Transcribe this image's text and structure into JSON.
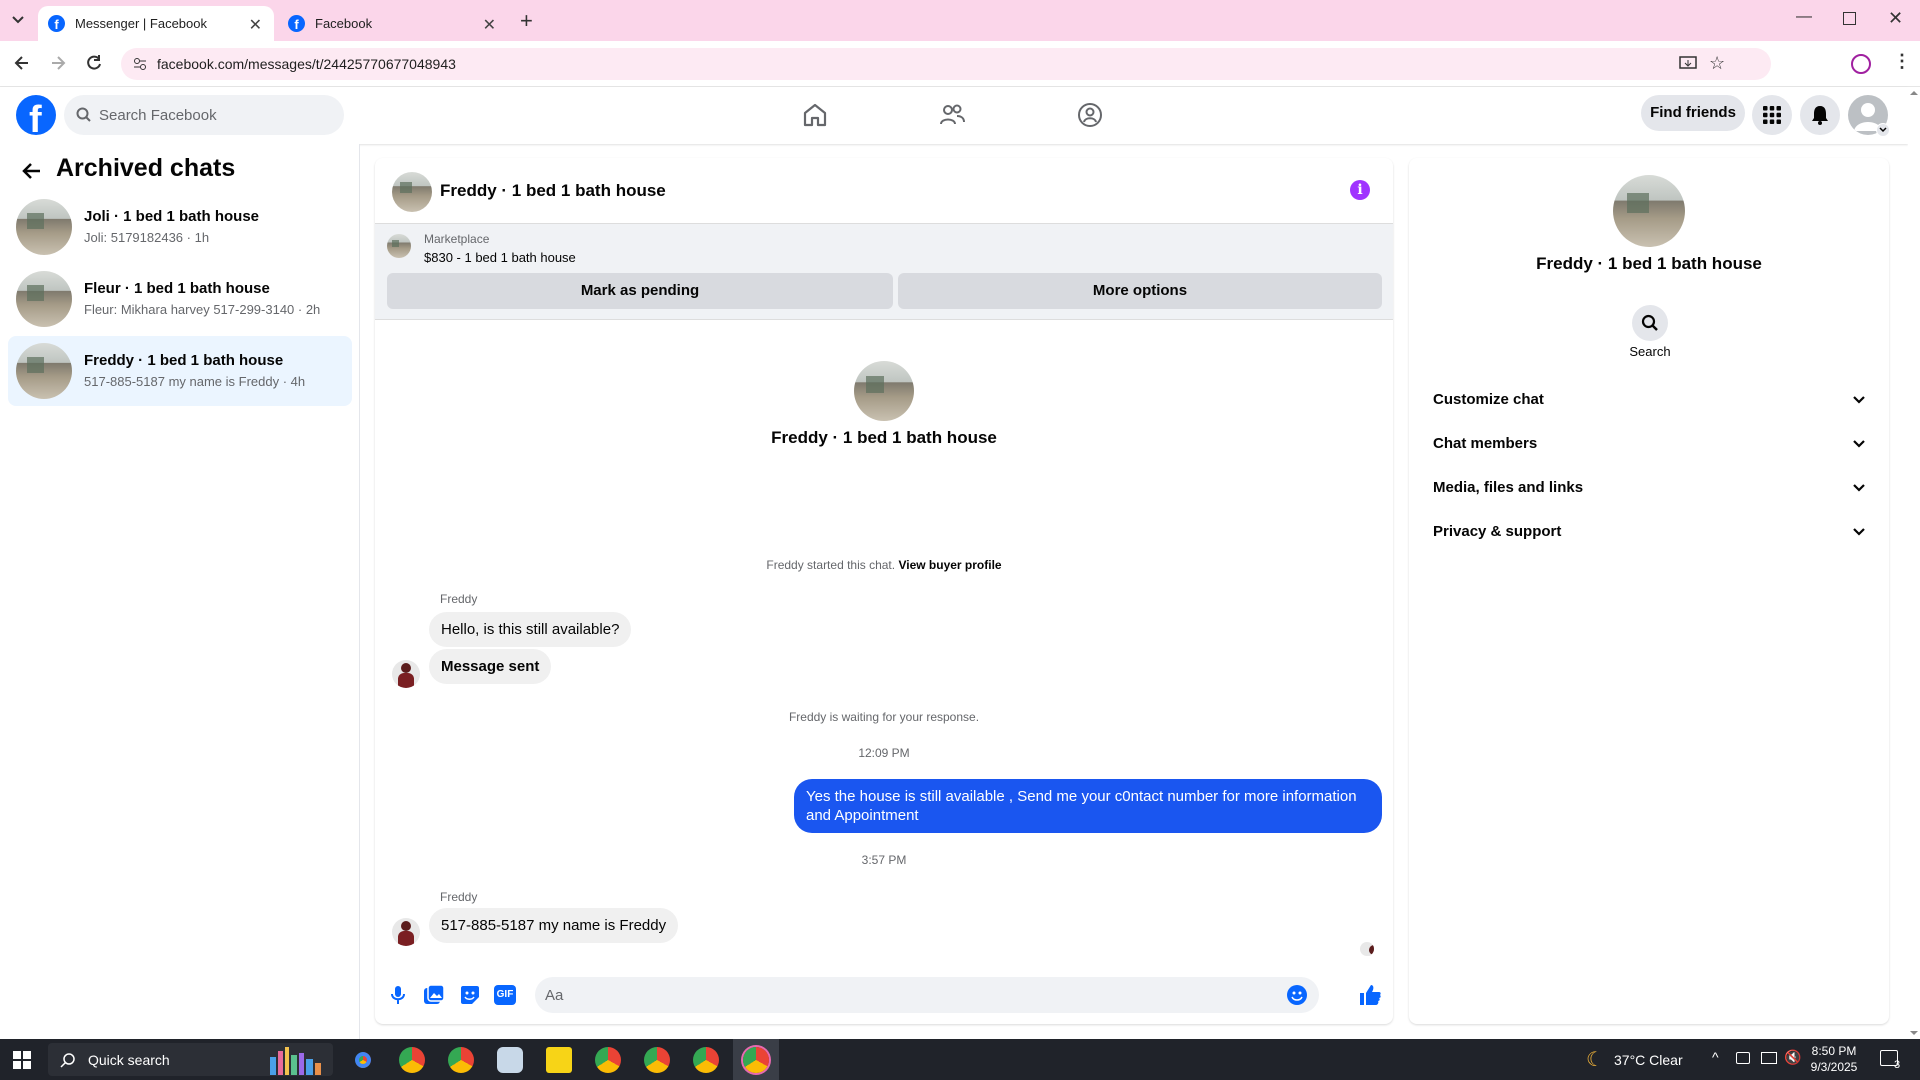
{
  "browser": {
    "tabs": [
      {
        "label": "Messenger | Facebook",
        "active": true
      },
      {
        "label": "Facebook",
        "active": false
      }
    ],
    "url": "facebook.com/messages/t/24425770677048943"
  },
  "header": {
    "search_placeholder": "Search Facebook",
    "find_friends": "Find friends"
  },
  "sidebar": {
    "title": "Archived chats",
    "chats": [
      {
        "name": "Joli · 1 bed 1 bath house",
        "preview": "Joli: 5179182436 · 1h"
      },
      {
        "name": "Fleur · 1 bed 1 bath house",
        "preview": "Fleur: Mikhara harvey 517-299-3140 · 2h"
      },
      {
        "name": "Freddy · 1 bed 1 bath house",
        "preview": "517-885-5187 my name is Freddy · 4h"
      }
    ]
  },
  "chat": {
    "title": "Freddy · 1 bed 1 bath house",
    "marketplace_label": "Marketplace",
    "marketplace_item": "$830 - 1 bed 1 bath house",
    "mark_pending": "Mark as pending",
    "more_options": "More options",
    "intro_name": "Freddy · 1 bed 1 bath house",
    "started_text": "Freddy started this chat.",
    "view_buyer": "View buyer profile",
    "sender1": "Freddy",
    "msg1": "Hello, is this still available?",
    "msg2": "Message sent",
    "waiting": "Freddy is waiting for your response.",
    "time1": "12:09 PM",
    "out_msg": "Yes the house is still available , Send me your c0ntact number for more information and Appointment",
    "time2": "3:57 PM",
    "sender2": "Freddy",
    "msg3": "517-885-5187 my name is Freddy",
    "input_placeholder": "Aa"
  },
  "details": {
    "name": "Freddy · 1 bed 1 bath house",
    "search_label": "Search",
    "sections": [
      "Customize chat",
      "Chat members",
      "Media, files and links",
      "Privacy & support"
    ]
  },
  "taskbar": {
    "search": "Quick search",
    "weather": "37°C  Clear",
    "time": "8:50 PM",
    "date": "9/3/2025",
    "notif_count": "3"
  },
  "colors": {
    "accent": "#0866ff",
    "outgoing_bubble": "#1a56f0",
    "info": "#a033ff",
    "tabbar": "#fbd6ea"
  }
}
